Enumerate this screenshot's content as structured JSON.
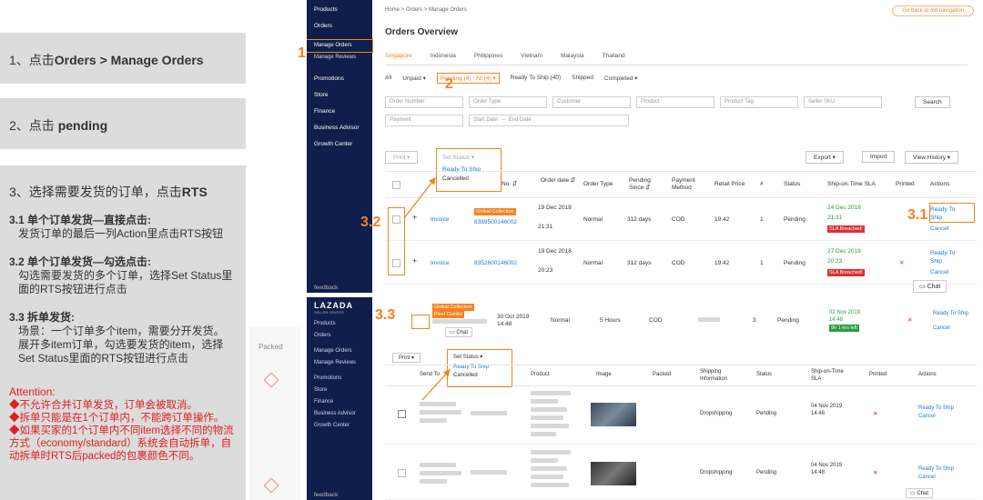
{
  "steps": {
    "s1_prefix": "1、点击",
    "s1_bold": "Orders > Manage Orders",
    "s2_prefix": "2、点击 ",
    "s2_bold": "pending",
    "s3_prefix": "3、选择需要发货的订单，点击",
    "s3_bold": "RTS",
    "s31_head": "3.1 单个订单发货—直接点击:",
    "s31_text": "发货订单的最后一列Action里点击RTS按钮",
    "s32_head": "3.2 单个订单发货—勾选点击:",
    "s32_text": "勾选需要发货的多个订单，选择Set Status里面的RTS按钮进行点击",
    "s33_head": "3.3 拆单发货:",
    "s33_text1": "场景：一个订单多个item，需要分开发货。",
    "s33_text2": "展开多item订单，勾选要发货的item，选择Set Status里面的RTS按钮进行点击",
    "attention_title": "Attention:",
    "attention": [
      "◆不允许合并订单发货，订单会被取消。",
      "◆拆单只能是在1个订单内，不能跨订单操作。",
      "◆如果买家的1个订单内不同item选择不同的物流方式（economy/standard）系统会自动拆单，自动拆单时RTS后packed的包裹颜色不同。"
    ]
  },
  "side": {
    "packed": "Packed"
  },
  "annotations": {
    "a1": "1",
    "a2": "2",
    "a32": "3.2",
    "a31": "3.1",
    "a33": "3.3"
  },
  "shotA": {
    "nav": [
      "Products",
      "Orders",
      "Manage Orders",
      "Manage Reviews",
      "Promotions",
      "Store",
      "Finance",
      "Business Advisor",
      "Growth Center"
    ],
    "feedback": "feedback",
    "breadcrumb": "Home  >  Orders  >  Manage Orders",
    "oldnav": "Go back to old navigation",
    "title": "Orders Overview",
    "countries": [
      "Singapore",
      "Indonesia",
      "Philippines",
      "Vietnam",
      "Malaysia",
      "Thailand"
    ],
    "tabs": {
      "all": "All",
      "unpaid": "Unpaid ▾",
      "pending": "Pending (4) : All (4) ▾",
      "rts": "Ready To Ship (40)",
      "shipped": "Shipped",
      "completed": "Completed ▾"
    },
    "filters": {
      "order_number": "Order Number",
      "order_type": "Order Type",
      "customer": "Customer",
      "product": "Product",
      "product_tag": "Product Tag",
      "seller_sku": "Seller SKU",
      "payment": "Payment",
      "start_date": "Start Date",
      "dash": "–",
      "end_date": "End Date"
    },
    "search": "Search",
    "print": "Print  ▾",
    "set_status": "Set Status  ▾",
    "dd_rts": "Ready To Ship",
    "dd_cancelled": "Cancelled",
    "export": "Export  ▾",
    "import": "Import",
    "view_history": "View History  ▾",
    "headers": {
      "no": "No. ⇵",
      "order_date": "Order date ⇵",
      "order_type": "Order Type",
      "pending_since": "Pending Since ⇵",
      "payment_method": "Payment Method",
      "retail_price": "Retail Price",
      "hash": "#",
      "status": "Status",
      "sla": "Ship-on-Time SLA",
      "printed": "Printed",
      "actions": "Actions"
    },
    "rows": [
      {
        "invoice": "Invoice",
        "tag": "Global Collection",
        "order_no": "8389500146002",
        "date": "19 Dec 2018",
        "time": "21:31",
        "type": "Normal",
        "pending": "312 days",
        "payment": "COD",
        "price": "19.42",
        "qty": "1",
        "status": "Pending",
        "sla_date": "24 Dec 2018",
        "sla_time": "21:31",
        "sla_tag": "SLA Breached!",
        "printed": "",
        "rts": "Ready To Ship",
        "cancel": "Cancel"
      },
      {
        "invoice": "Invoice",
        "tag": "",
        "order_no": "8352600146002",
        "date": "19 Dec 2018",
        "time": "20:23",
        "type": "Normal",
        "pending": "312 days",
        "payment": "COD",
        "price": "19.42",
        "qty": "1",
        "status": "Pending",
        "sla_date": "27 Dec 2018",
        "sla_time": "20:23",
        "sla_tag": "SLA Breached!",
        "printed": "✕",
        "rts": "Ready To Ship",
        "cancel": "Cancel"
      }
    ],
    "chat": "Chat"
  },
  "shotB": {
    "logo": "LAZADA",
    "logo_sub": "SELLER CENTER",
    "nav": [
      "Products",
      "Orders",
      "Manage Orders",
      "Manage Reviews",
      "Promotions",
      "Store",
      "Finance",
      "Business Advisor",
      "Growth Center"
    ],
    "feedback": "feedback",
    "top": {
      "tag1": "Global Collection",
      "tag2": "Pixel Combo",
      "date": "30 Oct 2019",
      "time": "14:48",
      "type": "Normal",
      "pending": "5 Hours",
      "payment": "COD",
      "qty": "3",
      "status": "Pending",
      "sla_date": "02 Nov 2019",
      "sla_time": "14:48",
      "sla_tag": "9h 1 hrs left",
      "rts": "Ready To Ship",
      "cancel": "Cancel",
      "chat": "Chat"
    },
    "print": "Print  ▾",
    "set_status": "Set Status  ▾",
    "dd_rts": "Ready To Ship",
    "dd_cancelled": "Cancelled",
    "headers": {
      "send_to": "Send To",
      "product": "Product",
      "image": "Image",
      "packed": "Packed",
      "shipping": "Shipping Information",
      "status": "Status",
      "sla": "Ship-on-Time SLA",
      "printed": "Printed",
      "actions": "Actions"
    },
    "items": [
      {
        "shipping": "Dropshipping",
        "status": "Pending",
        "sla_date": "04 Nov 2019",
        "sla_time": "14:48",
        "printed": "✕",
        "rts": "Ready To Ship",
        "cancel": "Cancel"
      },
      {
        "shipping": "Dropshipping",
        "status": "Pending",
        "sla_date": "04 Nov 2019",
        "sla_time": "14:48",
        "printed": "✕",
        "rts": "Ready To Ship",
        "cancel": "Cancel"
      }
    ],
    "chat": "Chat"
  },
  "colors": {
    "accent": "#f58220",
    "nav": "#0f1e4a",
    "link": "#1a7ad9",
    "alert": "#e02020"
  }
}
